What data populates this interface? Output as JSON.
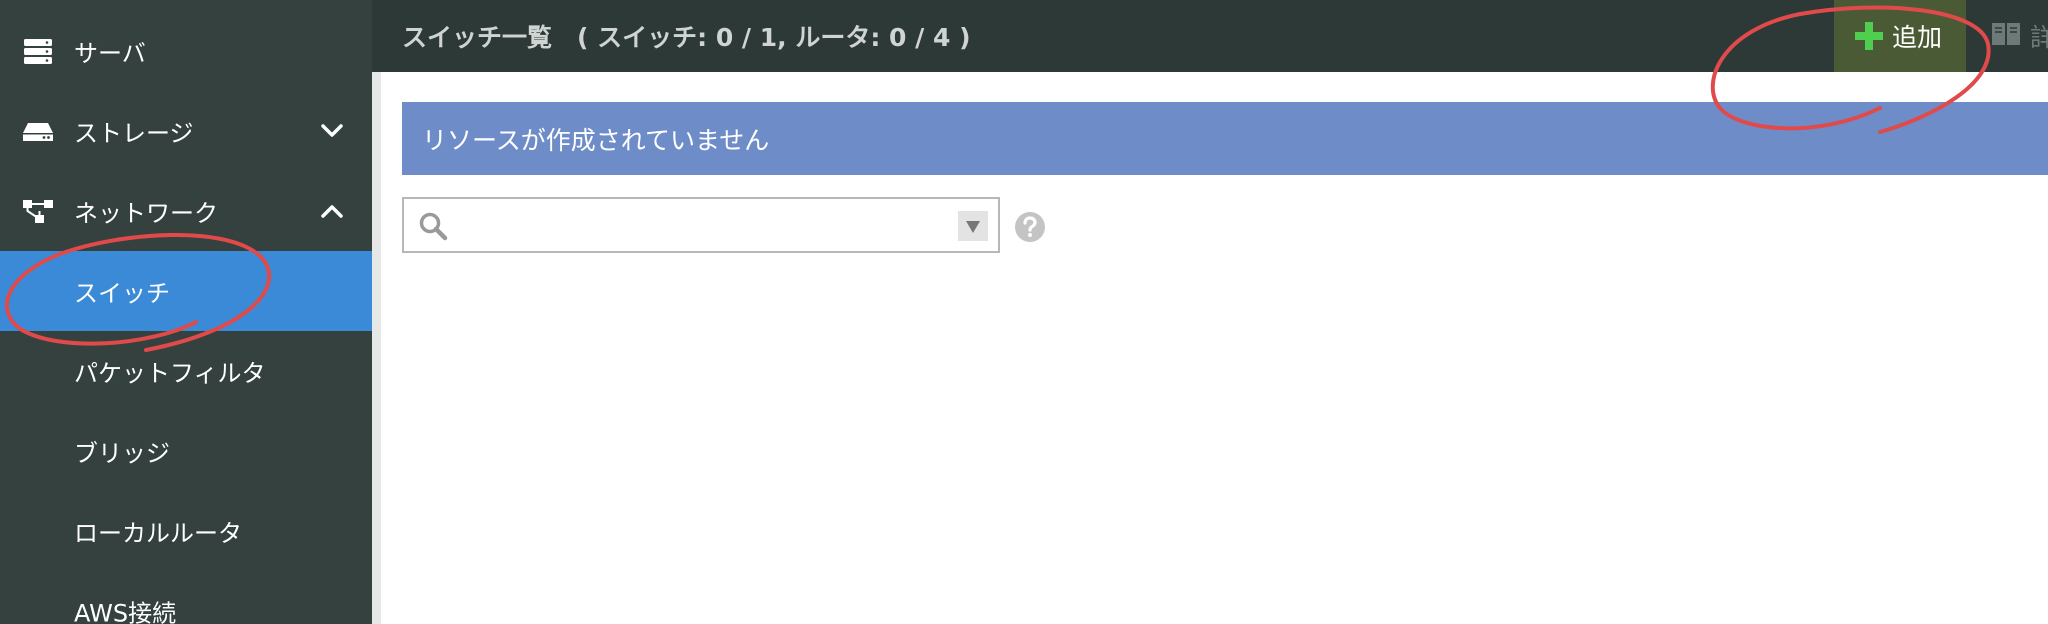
{
  "sidebar": {
    "items": [
      {
        "label": "サーバ"
      },
      {
        "label": "ストレージ"
      },
      {
        "label": "ネットワーク"
      },
      {
        "label": "スイッチ"
      },
      {
        "label": "パケットフィルタ"
      },
      {
        "label": "ブリッジ"
      },
      {
        "label": "ローカルルータ"
      },
      {
        "label": "AWS接続"
      }
    ]
  },
  "header": {
    "title": "スイッチ一覧　( スイッチ: 0 / 1, ルータ: 0 / 4 )",
    "add_label": "追加",
    "cut_label": "詳"
  },
  "main": {
    "banner_text": "リソースが作成されていません",
    "search_placeholder": ""
  },
  "colors": {
    "sidebar_bg": "#34413e",
    "active_item": "#3a8ad8",
    "header_bg": "#2d3937",
    "add_button_bg": "#4a5a34",
    "plus_green": "#4fcf4f",
    "banner_bg": "#6e8cc8",
    "annotation_red": "#e14a4a"
  },
  "icons": {
    "server": "server-icon",
    "storage": "storage-icon",
    "network": "network-icon",
    "plus": "plus-icon",
    "book": "book-icon",
    "search": "search-icon",
    "dropdown": "caret-down-icon",
    "help": "help-icon"
  }
}
